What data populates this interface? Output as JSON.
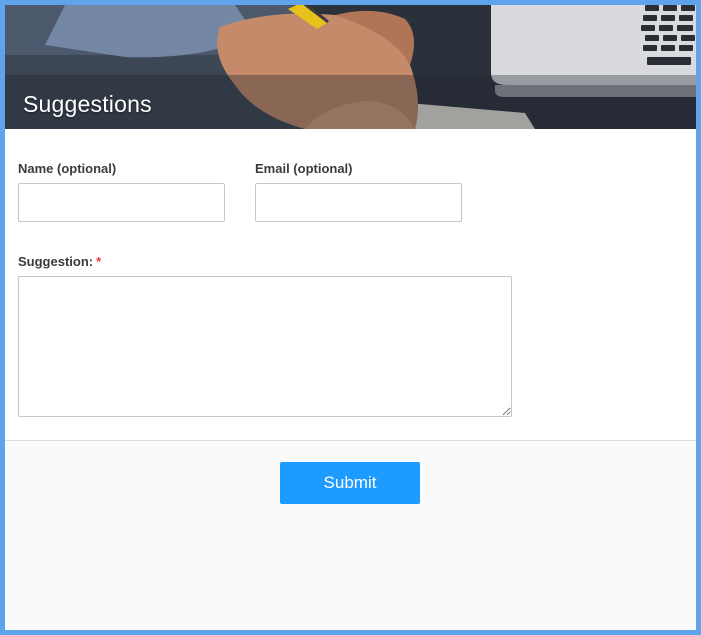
{
  "form": {
    "title": "Suggestions",
    "fields": {
      "name": {
        "label": "Name (optional)",
        "value": "",
        "placeholder": ""
      },
      "email": {
        "label": "Email (optional)",
        "value": "",
        "placeholder": ""
      },
      "suggestion": {
        "label": "Suggestion:",
        "required_marker": "*",
        "value": ""
      }
    },
    "submit_label": "Submit"
  },
  "colors": {
    "frame_border": "#5ea3ec",
    "submit_button": "#1e9bff",
    "required_marker": "#e0413b",
    "footer_background": "#fafafa"
  }
}
